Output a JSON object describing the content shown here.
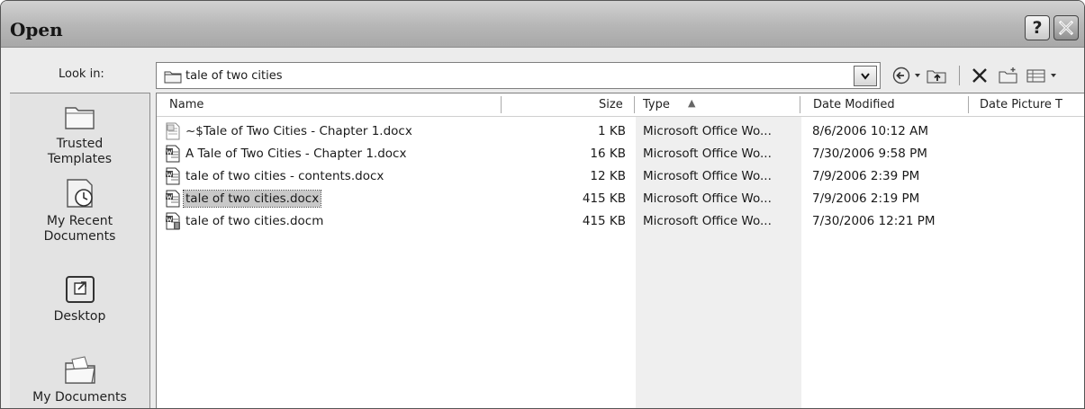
{
  "dialog": {
    "title": "Open",
    "help_label": "?"
  },
  "look_in": {
    "label": "Look in:",
    "value": "tale of two cities"
  },
  "places": [
    {
      "label": "Trusted Templates",
      "icon": "folder-icon"
    },
    {
      "label": "My Recent Documents",
      "icon": "recent-documents-icon"
    },
    {
      "label": "Desktop",
      "icon": "desktop-icon"
    },
    {
      "label": "My Documents",
      "icon": "my-documents-icon"
    }
  ],
  "columns": {
    "name": "Name",
    "size": "Size",
    "type": "Type",
    "date_modified": "Date Modified",
    "date_picture": "Date Picture T"
  },
  "sort": {
    "column": "type",
    "direction": "ascending",
    "indicator": "▲"
  },
  "files": [
    {
      "name": "~$Tale of Two Cities - Chapter 1.docx",
      "size": "1 KB",
      "type": "Microsoft Office Wo...",
      "date": "8/6/2006 10:12 AM",
      "icon": "temp-word-file-icon"
    },
    {
      "name": "A Tale of Two Cities - Chapter 1.docx",
      "size": "16 KB",
      "type": "Microsoft Office Wo...",
      "date": "7/30/2006 9:58 PM",
      "icon": "word-document-icon"
    },
    {
      "name": "tale of two cities - contents.docx",
      "size": "12 KB",
      "type": "Microsoft Office Wo...",
      "date": "7/9/2006 2:39 PM",
      "icon": "word-document-icon"
    },
    {
      "name": "tale of two cities.docx",
      "size": "415 KB",
      "type": "Microsoft Office Wo...",
      "date": "7/9/2006 2:19 PM",
      "icon": "word-document-icon",
      "selected": true
    },
    {
      "name": "tale of two cities.docm",
      "size": "415 KB",
      "type": "Microsoft Office Wo...",
      "date": "7/30/2006 12:21 PM",
      "icon": "word-macro-document-icon"
    }
  ],
  "colors": {
    "selection": "#c8c8c8",
    "sorted_column": "#efefef",
    "titlebar": "#b6b6b6"
  }
}
